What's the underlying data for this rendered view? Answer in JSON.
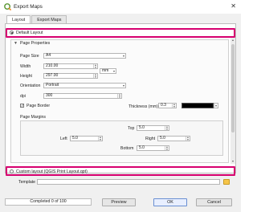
{
  "window": {
    "title": "Export Maps"
  },
  "tabs": [
    {
      "label": "Layout",
      "active": true
    },
    {
      "label": "Export Maps",
      "active": false
    }
  ],
  "layout_choice": {
    "default_label": "Default Layout",
    "default_selected": true,
    "custom_label": "Custom layout (QGIS Print Layout.qpt)",
    "custom_selected": false
  },
  "page_properties": {
    "header": "Page Properties",
    "page_size": {
      "label": "Page Size",
      "value": "A4"
    },
    "width": {
      "label": "Width",
      "value": "210.00"
    },
    "height": {
      "label": "Height",
      "value": "297.00"
    },
    "unit": {
      "value": "mm"
    },
    "orientation": {
      "label": "Orientation",
      "value": "Portrait"
    },
    "dpi": {
      "label": "dpi",
      "value": "300"
    },
    "page_border": {
      "label": "Page Border",
      "checked": true
    },
    "thickness": {
      "label": "Thickness (mm)",
      "value": "0.3"
    },
    "border_color": "#000000",
    "margins": {
      "header": "Page Margins",
      "top": {
        "label": "Top",
        "value": "5.0"
      },
      "left": {
        "label": "Left",
        "value": "5.0"
      },
      "right": {
        "label": "Right",
        "value": "5.0"
      },
      "bottom": {
        "label": "Bottom",
        "value": "5.0"
      }
    }
  },
  "template": {
    "label": "Template",
    "value": ""
  },
  "footer": {
    "progress_text": "Completed 0 of 100",
    "progress_fraction": 0,
    "preview_label": "Preview",
    "ok_label": "OK",
    "cancel_label": "Cancel"
  },
  "colors": {
    "highlight": "#d6006f",
    "accent": "#3daee9"
  }
}
